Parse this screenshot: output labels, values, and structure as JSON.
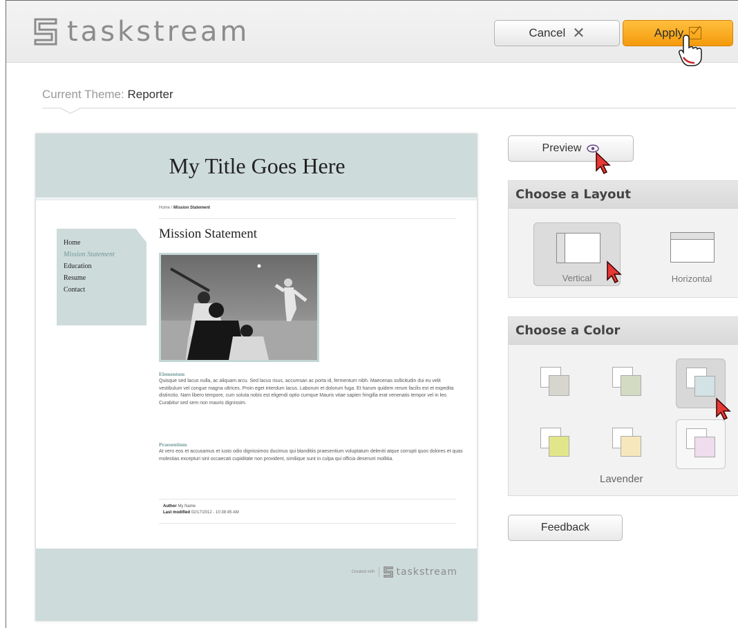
{
  "header": {
    "brand": "taskstream",
    "cancel_label": "Cancel",
    "apply_label": "Apply"
  },
  "theme": {
    "prefix": "Current Theme:",
    "name": "Reporter"
  },
  "preview": {
    "site_title": "My Title Goes Here",
    "breadcrumb_home": "Home",
    "breadcrumb_sep": " / ",
    "breadcrumb_current": "Mission Statement",
    "nav": [
      "Home",
      "Mission Statement",
      "Education",
      "Resume",
      "Contact"
    ],
    "page_title": "Mission Statement",
    "section1_heading": "Elementum",
    "section1_text": "Quisque sed lacus nulla, ac aliquam arcu. Sed lacus risus, accumsan ac porta id, fermentum nibh. Maecenas sollicitudin dui eu velit vestibulum vel congue magna ultrices. Proin eget interdum lacus. Laborum et dolorum fuga. Et harum quidem rerum facilis est et expedita distinctio. Nam libero tempore, cum soluta nobis est eligendi optio cumque Mauris vitae sapien fringilla erat venenatis tempor vel in leo. Curabitur sed sem non mauris dignissim.",
    "section2_heading": "Praesentium",
    "section2_text": "At vero eos et accusamus et iusto odio dignissimos ducimus qui blanditiis praesentium voluptatum deleniti atque corrupti quos dolores et quas molestias excepturi sint occaecati cupiditate non provident, similique sunt in culpa qui officia deserunt mollitia.",
    "author_label": "Author",
    "author_value": "My Name",
    "modified_label": "Last modified",
    "modified_value": "02/17/2012 - 10:38:45 AM",
    "footer_created": "Created with",
    "footer_brand": "taskstream",
    "accent_color": "#cddbda"
  },
  "controls": {
    "preview_label": "Preview",
    "layout_heading": "Choose a Layout",
    "layouts": [
      {
        "label": "Vertical",
        "selected": true
      },
      {
        "label": "Horizontal",
        "selected": false
      }
    ],
    "color_heading": "Choose a Color",
    "colors": [
      {
        "hex": "#d6d6ce",
        "selected": false
      },
      {
        "hex": "#d3dcc3",
        "selected": false
      },
      {
        "hex": "#d3e2e4",
        "selected": true
      },
      {
        "hex": "#e2e68a",
        "selected": false
      },
      {
        "hex": "#f7e7bd",
        "selected": false
      },
      {
        "hex": "#efdcec",
        "selected": false
      }
    ],
    "hover_color_label": "Lavender",
    "feedback_label": "Feedback"
  }
}
